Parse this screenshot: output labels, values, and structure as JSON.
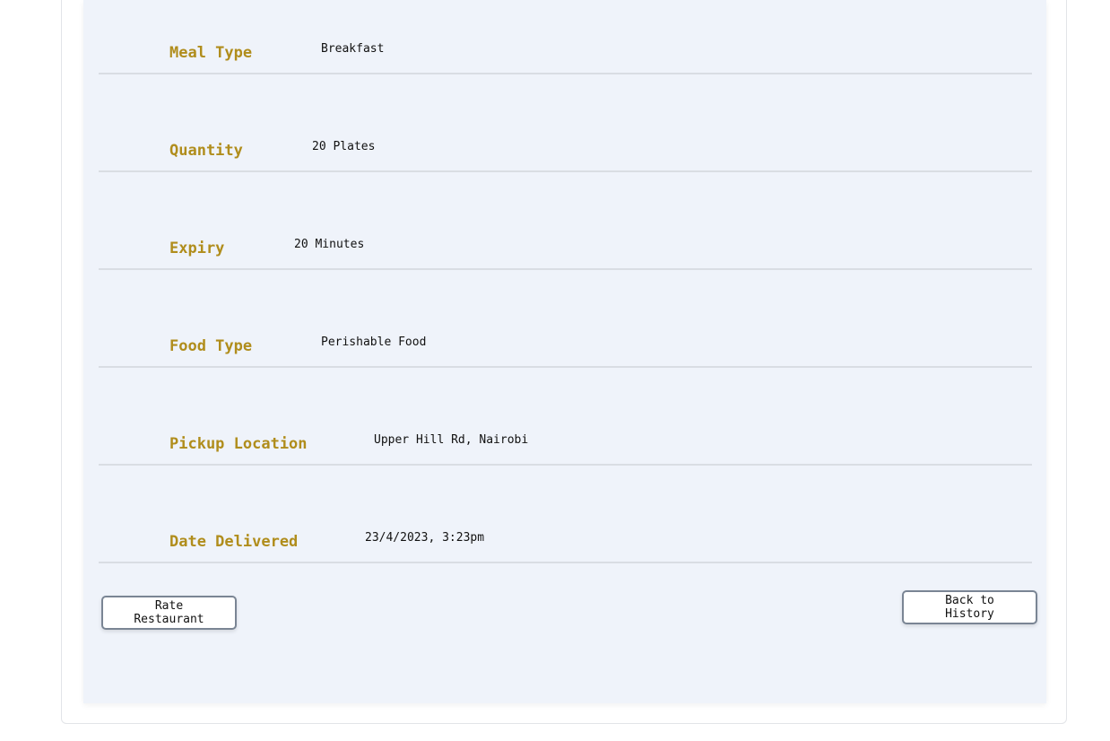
{
  "details": [
    {
      "label": "Meal Type",
      "value": "Breakfast"
    },
    {
      "label": "Quantity",
      "value": "20 Plates"
    },
    {
      "label": "Expiry",
      "value": "20 Minutes"
    },
    {
      "label": "Food Type",
      "value": "Perishable Food"
    },
    {
      "label": "Pickup Location",
      "value": "Upper Hill Rd, Nairobi"
    },
    {
      "label": "Date Delivered",
      "value": "23/4/2023, 3:23pm"
    }
  ],
  "actions": {
    "rate_label": "Rate Restaurant",
    "back_label": "Back to History"
  },
  "colors": {
    "label": "#b08d1c",
    "panel_background": "#eff3fa",
    "divider": "#d9dde3"
  }
}
